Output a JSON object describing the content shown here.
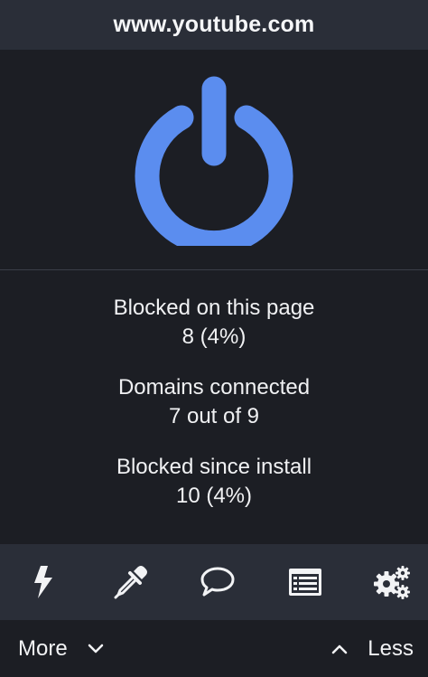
{
  "header": {
    "hostname": "www.youtube.com"
  },
  "power": {
    "icon": "power-icon",
    "state": "enabled",
    "color": "#5b8def"
  },
  "stats": [
    {
      "label": "Blocked on this page",
      "value": "8 (4%)"
    },
    {
      "label": "Domains connected",
      "value": "7 out of 9"
    },
    {
      "label": "Blocked since install",
      "value": "10 (4%)"
    }
  ],
  "toolbar": {
    "icons": [
      "lightning-icon",
      "eyedropper-icon",
      "speech-bubble-icon",
      "logger-icon",
      "gears-icon"
    ]
  },
  "footer": {
    "more_label": "More",
    "less_label": "Less"
  },
  "colors": {
    "background": "#1c1e24",
    "surface": "#2a2e38",
    "accent": "#5b8def",
    "text": "#f2f3f5"
  }
}
